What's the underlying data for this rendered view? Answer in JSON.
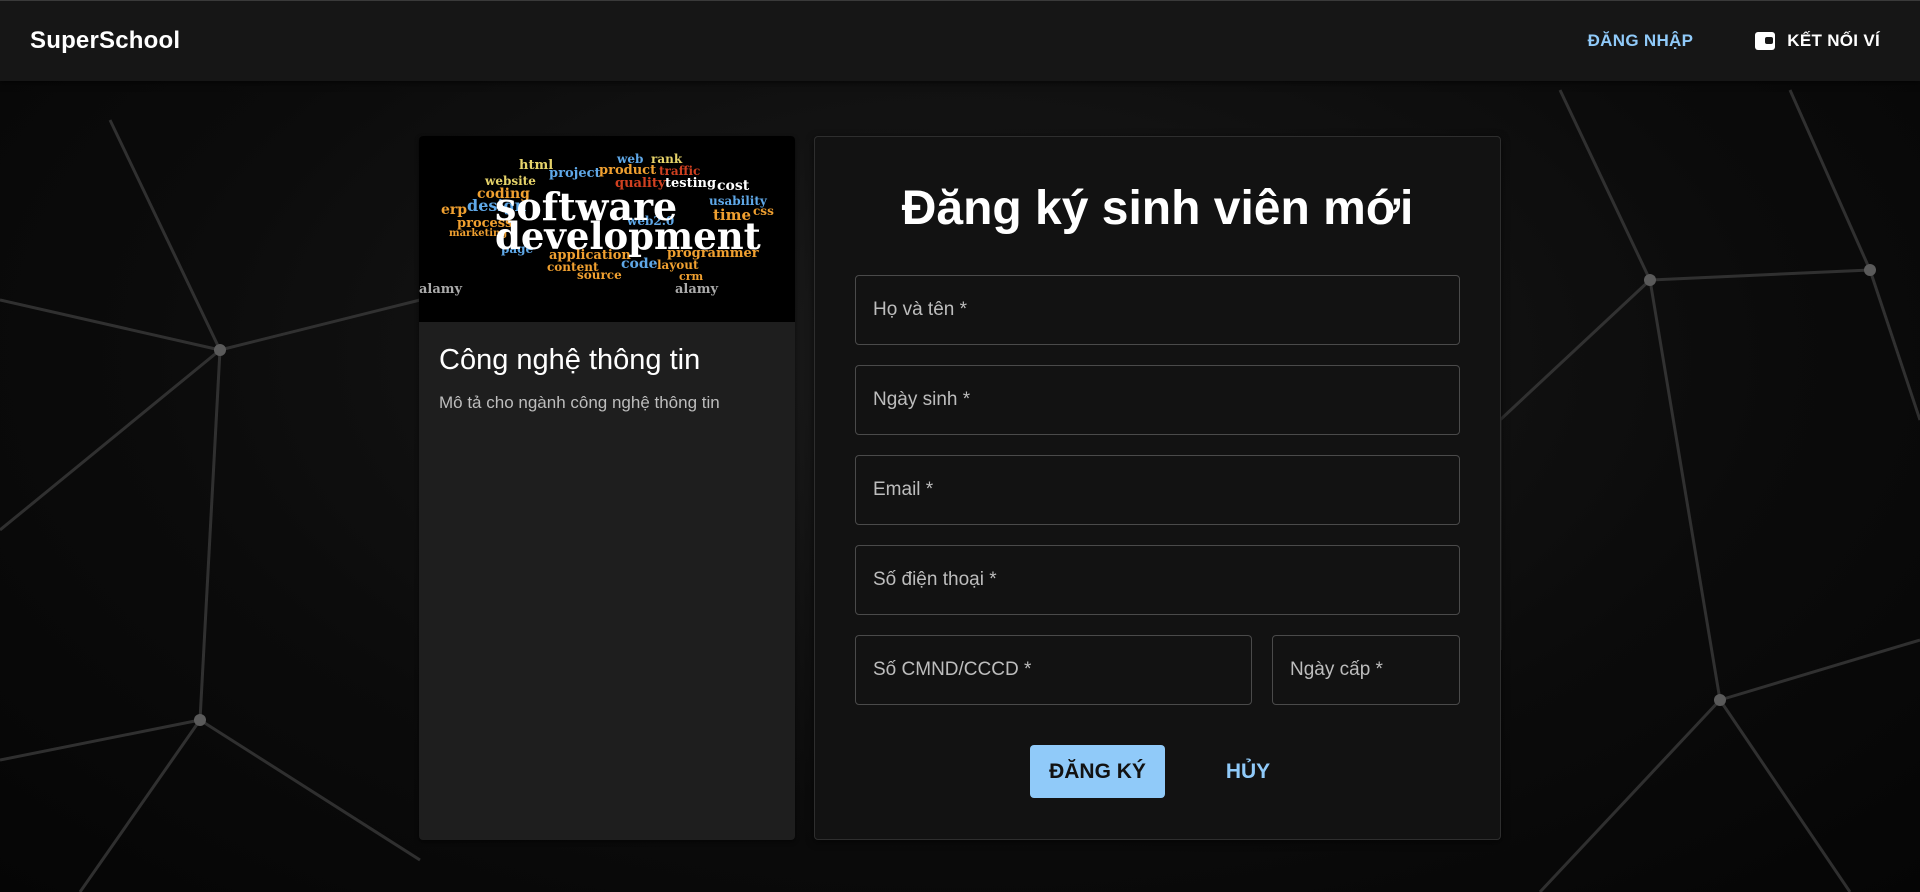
{
  "appbar": {
    "brand": "SuperSchool",
    "login_label": "ĐĂNG NHẬP",
    "wallet_label": "KẾT NỐI VÍ"
  },
  "major_card": {
    "title": "Công nghệ thông tin",
    "description": "Mô tả cho ngành công nghệ thông tin",
    "image_words": {
      "main1": "software",
      "main2": "development",
      "others": [
        "html",
        "project",
        "web",
        "rank",
        "website",
        "product",
        "traffic",
        "testing",
        "cost",
        "coding",
        "quality",
        "usability",
        "erp",
        "design",
        "time",
        "css",
        "process",
        "web2.0",
        "marketing",
        "application",
        "programmer",
        "page",
        "content",
        "code",
        "layout",
        "source",
        "crm",
        "alamy"
      ]
    }
  },
  "form": {
    "title": "Đăng ký sinh viên mới",
    "fields": {
      "full_name": "Họ và tên *",
      "dob": "Ngày sinh *",
      "email": "Email *",
      "phone": "Số điện thoại *",
      "id_number": "Số CMND/CCCD *",
      "issue_date": "Ngày cấp *"
    },
    "submit_label": "ĐĂNG KÝ",
    "cancel_label": "HỦY"
  },
  "colors": {
    "accent": "#90caf9",
    "appbar_bg": "#161616",
    "panel_bg": "#121212",
    "card_bg": "#1e1e1e"
  },
  "icons": {
    "wallet": "wallet-icon"
  }
}
